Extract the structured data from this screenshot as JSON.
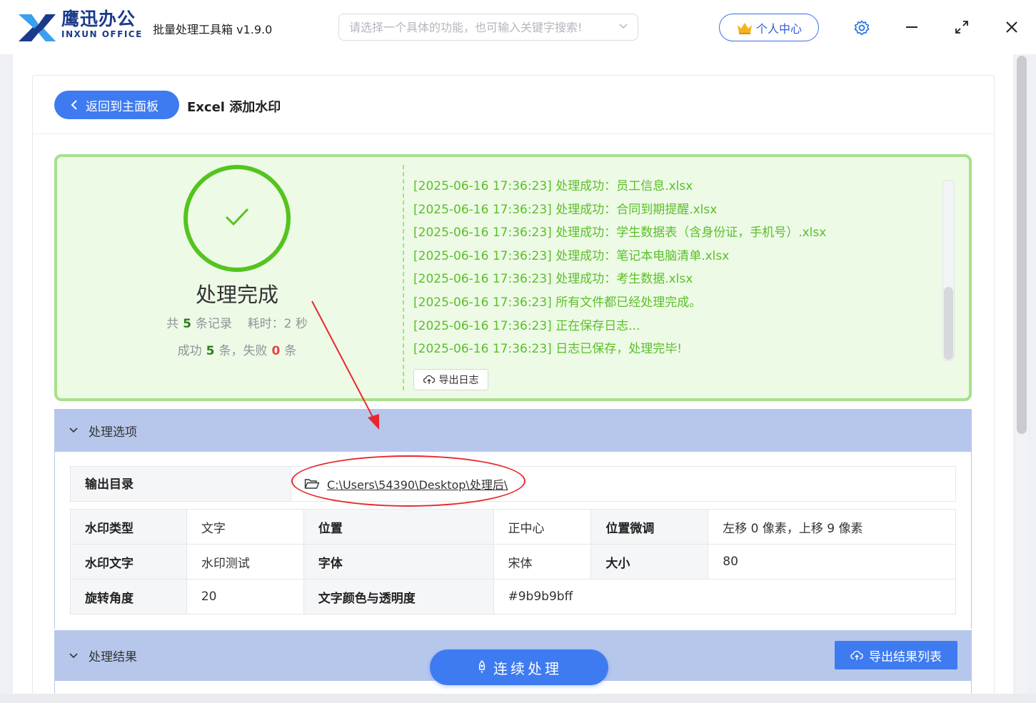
{
  "app": {
    "brand_cn": "鹰迅办公",
    "brand_en": "INXUN OFFICE",
    "title": "批量处理工具箱 v1.9.0",
    "search_placeholder": "请选择一个具体的功能，也可输入关键字搜索!",
    "user_center": "个人中心",
    "colors": {
      "accent": "#3f7bf0",
      "brand": "#1b3a8a",
      "success": "#54c41e",
      "danger": "#e54545"
    }
  },
  "header": {
    "back_label": "返回到主面板",
    "page_title": "Excel 添加水印"
  },
  "result": {
    "title": "处理完成",
    "total_prefix": "共",
    "total_count": "5",
    "total_suffix": "条记录",
    "time_text": "耗时：2 秒",
    "success_prefix": "成功",
    "success_count": "5",
    "success_suffix": "条，失败",
    "fail_count": "0",
    "fail_suffix": "条",
    "export_log": "导出日志",
    "log_lines": [
      "[2025-06-16 17:36:23] 处理成功：员工信息.xlsx",
      "[2025-06-16 17:36:23] 处理成功：合同到期提醒.xlsx",
      "[2025-06-16 17:36:23] 处理成功：学生数据表（含身份证，手机号）.xlsx",
      "[2025-06-16 17:36:23] 处理成功：笔记本电脑清单.xlsx",
      "[2025-06-16 17:36:23] 处理成功：考生数据.xlsx",
      "[2025-06-16 17:36:23] 所有文件都已经处理完成。",
      "[2025-06-16 17:36:23] 正在保存日志...",
      "[2025-06-16 17:36:23] 日志已保存，处理完毕!"
    ]
  },
  "options": {
    "section_title": "处理选项",
    "output_label": "输出目录",
    "output_path": "C:\\Users\\54390\\Desktop\\处理后\\",
    "rows": [
      [
        "水印类型",
        "文字",
        "位置",
        "正中心",
        "位置微调",
        "左移 0 像素，上移 9 像素"
      ],
      [
        "水印文字",
        "水印测试",
        "字体",
        "宋体",
        "大小",
        "80"
      ],
      [
        "旋转角度",
        "20",
        "文字颜色与透明度",
        "#9b9b9bff",
        "",
        ""
      ]
    ]
  },
  "results": {
    "section_title": "处理结果",
    "export_list": "导出结果列表"
  },
  "actions": {
    "continue": "连续处理"
  }
}
